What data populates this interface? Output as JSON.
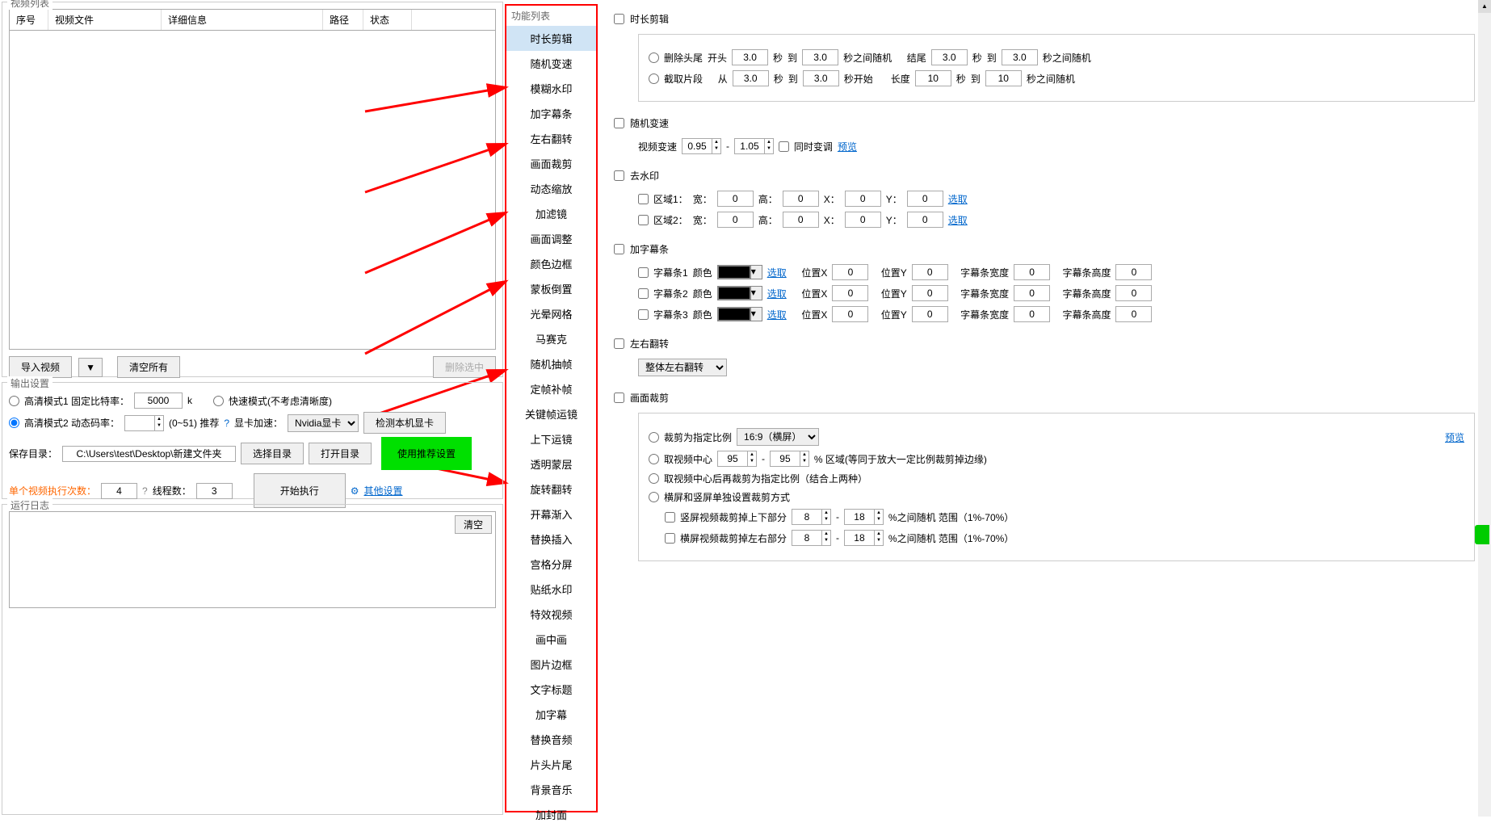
{
  "left": {
    "videoListTitle": "视频列表",
    "columns": {
      "num": "序号",
      "file": "视频文件",
      "detail": "详细信息",
      "path": "路径",
      "status": "状态"
    },
    "importBtn": "导入视频",
    "clearAllBtn": "清空所有",
    "deleteSelectedBtn": "删除选中"
  },
  "output": {
    "title": "输出设置",
    "mode1Label": "高清模式1 固定比特率：",
    "mode1Value": "5000",
    "mode1Unit": "k",
    "fastMode": "快速模式(不考虑清晰度)",
    "mode2Label": "高清模式2 动态码率：",
    "mode2Value": "",
    "mode2Range": "(0~51)  推荐",
    "gpuLabel": "显卡加速：",
    "gpuValue": "Nvidia显卡",
    "detectGpu": "检测本机显卡",
    "saveDirLabel": "保存目录：",
    "saveDirValue": "C:\\Users\\test\\Desktop\\新建文件夹",
    "chooseDir": "选择目录",
    "openDir": "打开目录",
    "useRecommended": "使用推荐设置",
    "singleCountLabel": "单个视频执行次数：",
    "singleCountValue": "4",
    "threadLabel": "线程数：",
    "threadValue": "3",
    "startBtn": "开始执行",
    "otherSettings": "其他设置",
    "help": "?"
  },
  "log": {
    "title": "运行日志",
    "clear": "清空"
  },
  "funcList": {
    "title": "功能列表",
    "items": [
      "时长剪辑",
      "随机变速",
      "模糊水印",
      "加字幕条",
      "左右翻转",
      "画面裁剪",
      "动态缩放",
      "加滤镜",
      "画面调整",
      "颜色边框",
      "蒙板倒置",
      "光晕网格",
      "马赛克",
      "随机抽帧",
      "定帧补帧",
      "关键帧运镜",
      "上下运镜",
      "透明蒙层",
      "旋转翻转",
      "开幕渐入",
      "替换插入",
      "宫格分屏",
      "贴纸水印",
      "特效视频",
      "画中画",
      "图片边框",
      "文字标题",
      "加字幕",
      "替换音频",
      "片头片尾",
      "背景音乐",
      "加封面"
    ]
  },
  "right": {
    "duration": {
      "title": "时长剪辑",
      "trimLabel": "删除头尾",
      "headLabel": "开头",
      "sec": "秒",
      "to": "到",
      "randomBetween": "秒之间随机",
      "tailLabel": "结尾",
      "clipLabel": "截取片段",
      "from": "从",
      "start": "秒开始",
      "len": "长度",
      "v1": "3.0",
      "v2": "3.0",
      "v3": "3.0",
      "v4": "3.0",
      "v5": "3.0",
      "v6": "3.0",
      "v7": "10",
      "v8": "10"
    },
    "speed": {
      "title": "随机变速",
      "label": "视频变速",
      "min": "0.95",
      "max": "1.05",
      "sync": "同时变调",
      "preview": "预览"
    },
    "watermark": {
      "title": "去水印",
      "area1": "区域1：",
      "area2": "区域2：",
      "w": "宽：",
      "h": "高：",
      "x": "X：",
      "y": "Y：",
      "select": "选取",
      "zeros": "0"
    },
    "subtitle": {
      "title": "加字幕条",
      "bar1": "字幕条1",
      "bar2": "字幕条2",
      "bar3": "字幕条3",
      "color": "颜色",
      "select": "选取",
      "posX": "位置X",
      "posY": "位置Y",
      "width": "字幕条宽度",
      "height": "字幕条高度",
      "zero": "0"
    },
    "flip": {
      "title": "左右翻转",
      "option": "整体左右翻转"
    },
    "crop": {
      "title": "画面裁剪",
      "byRatio": "裁剪为指定比例",
      "ratio": "16:9（横屏）",
      "preview": "预览",
      "center": "取视频中心",
      "centerMin": "95",
      "centerMax": "95",
      "centerSuffix": "% 区域(等同于放大一定比例裁剪掉边缘)",
      "both": "取视频中心后再裁剪为指定比例（结合上两种）",
      "hvSeparate": "横屏和竖屏单独设置裁剪方式",
      "vCrop": "竖屏视频裁剪掉上下部分",
      "hCrop": "横屏视频裁剪掉左右部分",
      "rangeMin": "8",
      "rangeMax": "18",
      "rangeSuffix": "%之间随机 范围（1%-70%）"
    }
  }
}
